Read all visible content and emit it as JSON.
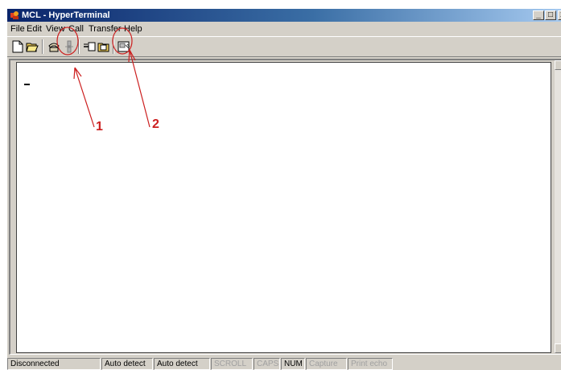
{
  "window": {
    "title": "MCL - HyperTerminal",
    "controls": {
      "minimize": "_",
      "maximize": "□",
      "close": "x"
    }
  },
  "menu": [
    "File",
    "Edit",
    "View",
    "Call",
    "Transfer",
    "Help"
  ],
  "toolbar": {
    "buttons": [
      "new-connection",
      "open",
      "dial",
      "disconnect",
      "send",
      "receive",
      "properties"
    ]
  },
  "status": {
    "connection": "Disconnected",
    "detect1": "Auto detect",
    "detect2": "Auto detect",
    "scroll": "SCROLL",
    "caps": "CAPS",
    "num": "NUM",
    "capture": "Capture",
    "print_echo": "Print echo"
  },
  "annotations": {
    "label1": "1",
    "label2": "2",
    "color": "#cc1f1f"
  },
  "colors": {
    "titlebar_start": "#0a246a",
    "titlebar_end": "#a6caf0",
    "chrome": "#d4d0c8"
  }
}
